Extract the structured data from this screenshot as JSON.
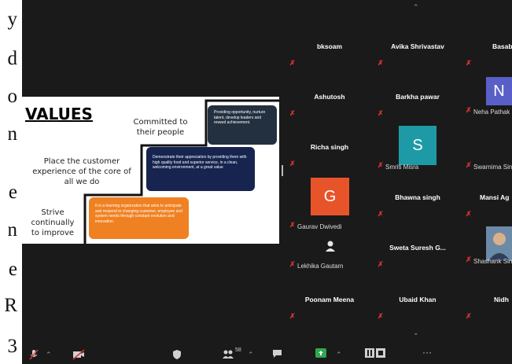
{
  "background_text": {
    "letters": [
      "y",
      "d",
      "o",
      "n",
      "",
      "e",
      "n",
      "e",
      "R",
      "3"
    ]
  },
  "slide": {
    "title": "VALUES",
    "committed": "Committed to their people",
    "place": "Place the customer experience of the core of all we do",
    "strive": "Strive continually to improve",
    "box_top": "Providing opportunity, nurture talent, develop leaders and reward achievement.",
    "box_mid": "Demonstrate their appreciation by providing them with high quality food and superior service, in a clean, welcoming environment, at a great value",
    "box_low": "It is a learning organization that aims to anticipate and respond to changing customer, employee and system needs through constant evolution and innovation."
  },
  "participants": {
    "bksoam": "bksoam",
    "avika": "Avika Shrivastav",
    "basab": "Basab",
    "ashutosh": "Ashutosh",
    "barkha": "Barkha pawar",
    "neha": "Neha Pathak",
    "neha_initial": "N",
    "richa": "Richa singh",
    "smriti": "Smriti Misra",
    "smriti_initial": "S",
    "swarnima": "Swarnima Sing",
    "gaurav": "Gaurav Dwivedi",
    "gaurav_initial": "G",
    "bhawna": "Bhawna singh",
    "mansi": "Mansi Ag",
    "lekhika": "Lekhika Gautam",
    "sweta": "Sweta Suresh G...",
    "shashank": "Shashank Sing",
    "poonam": "Poonam Meena",
    "ubaid": "Ubaid Khan",
    "nidh": "Nidh"
  },
  "toolbar": {
    "participants_count": "58"
  },
  "colors": {
    "meeting_bg": "#1a1a1a",
    "muted_red": "#d9352b",
    "avatar_n": "#5a5fc8",
    "avatar_s": "#1e9aa7",
    "avatar_g": "#e8542a",
    "box_dark": "#233040",
    "box_navy": "#16244f",
    "box_orange": "#f08122"
  }
}
